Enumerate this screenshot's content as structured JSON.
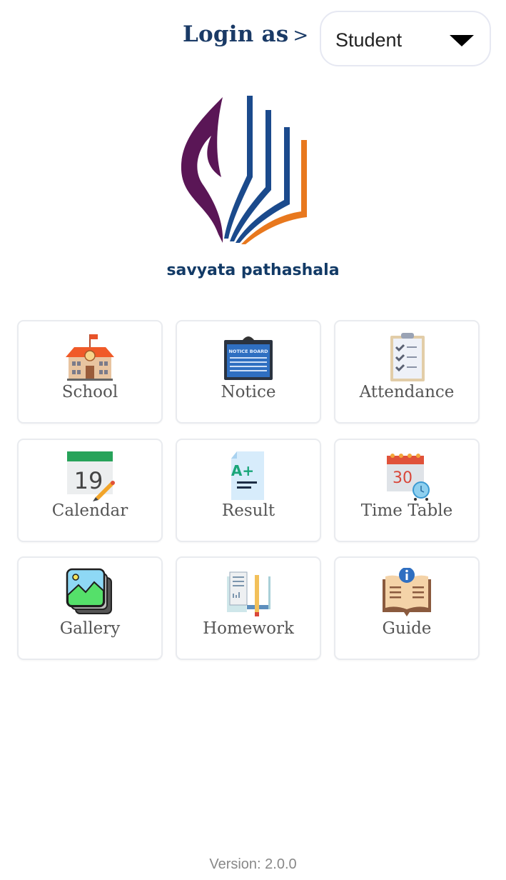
{
  "header": {
    "login_label": "Login as",
    "login_chevron": ">",
    "role_select": {
      "selected": "Student"
    }
  },
  "brand": {
    "name": "savyata pathashala",
    "colors": {
      "purple": "#5a1656",
      "blue": "#1b4a8c",
      "orange": "#e8781e",
      "text": "#123a66"
    }
  },
  "menu": {
    "items": [
      {
        "label": "School",
        "icon": "school-icon"
      },
      {
        "label": "Notice",
        "icon": "notice-board-icon"
      },
      {
        "label": "Attendance",
        "icon": "clipboard-checklist-icon"
      },
      {
        "label": "Calendar",
        "icon": "calendar-icon",
        "icon_text": "19"
      },
      {
        "label": "Result",
        "icon": "result-grade-icon",
        "icon_text": "A+"
      },
      {
        "label": "Time Table",
        "icon": "timetable-icon",
        "icon_text": "30"
      },
      {
        "label": "Gallery",
        "icon": "gallery-icon"
      },
      {
        "label": "Homework",
        "icon": "homework-icon"
      },
      {
        "label": "Guide",
        "icon": "guide-book-icon"
      }
    ],
    "notice_icon_text": "NOTICE BOARD"
  },
  "footer": {
    "version": "Version: 2.0.0"
  }
}
